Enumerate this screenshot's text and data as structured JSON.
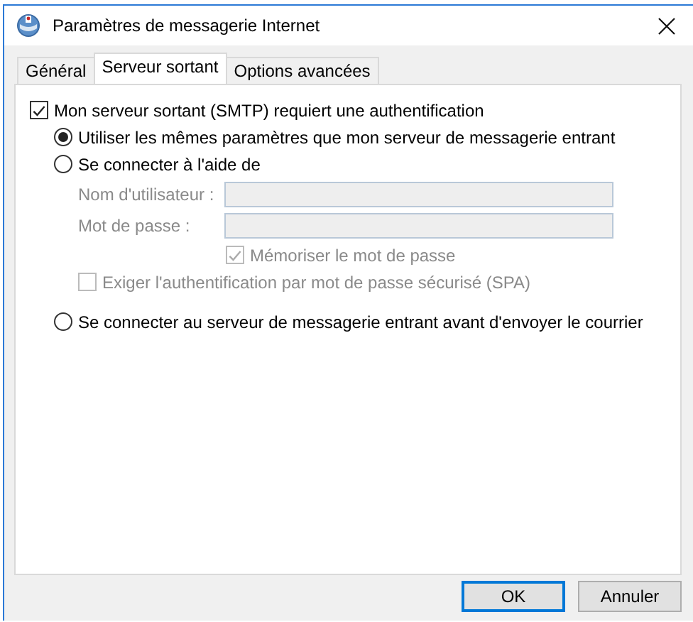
{
  "window": {
    "title": "Paramètres de messagerie Internet"
  },
  "tabs": [
    {
      "label": "Général",
      "selected": false
    },
    {
      "label": "Serveur sortant",
      "selected": true
    },
    {
      "label": "Options avancées",
      "selected": false
    }
  ],
  "require_auth": {
    "label": "Mon serveur sortant (SMTP) requiert une authentification",
    "checked": true
  },
  "auth_options": [
    {
      "label": "Utiliser les mêmes paramètres que mon serveur de messagerie entrant",
      "selected": true
    },
    {
      "label": "Se connecter à l'aide de",
      "selected": false
    }
  ],
  "credentials": {
    "disabled": true,
    "fields": [
      {
        "label": "Nom d'utilisateur :"
      },
      {
        "label": "Mot de passe :"
      }
    ],
    "remember": {
      "label": "Mémoriser le mot de passe",
      "checked": true
    },
    "spa": {
      "label": "Exiger l'authentification par mot de passe sécurisé (SPA)",
      "checked": false
    }
  },
  "pop_before_smtp": {
    "label": "Se connecter au serveur de messagerie entrant avant d'envoyer le courrier",
    "selected": false
  },
  "buttons": [
    {
      "label": "OK",
      "default": true
    },
    {
      "label": "Annuler",
      "default": false
    }
  ]
}
